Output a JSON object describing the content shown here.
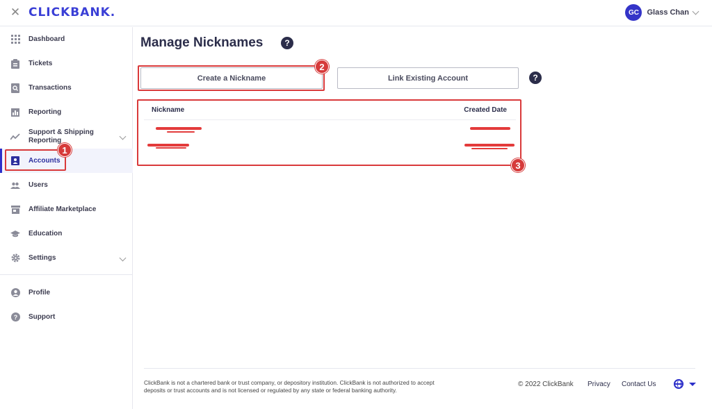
{
  "app": {
    "brand": "CLICKBANK.",
    "user_initials": "GC",
    "user_name": "Glass Chan"
  },
  "sidebar": {
    "items": [
      {
        "label": "Dashboard",
        "icon": "grid-icon"
      },
      {
        "label": "Tickets",
        "icon": "clipboard-icon"
      },
      {
        "label": "Transactions",
        "icon": "receipt-search-icon"
      },
      {
        "label": "Reporting",
        "icon": "bar-chart-icon"
      },
      {
        "label": "Support & Shipping Reporting",
        "icon": "trend-line-icon"
      },
      {
        "label": "Accounts",
        "icon": "account-badge-icon"
      },
      {
        "label": "Users",
        "icon": "users-icon"
      },
      {
        "label": "Affiliate Marketplace",
        "icon": "storefront-icon"
      },
      {
        "label": "Education",
        "icon": "graduation-cap-icon"
      },
      {
        "label": "Settings",
        "icon": "gear-icon"
      },
      {
        "label": "Profile",
        "icon": "person-icon"
      },
      {
        "label": "Support",
        "icon": "help-circle-icon"
      }
    ]
  },
  "main": {
    "title": "Manage Nicknames",
    "help_glyph": "?",
    "create_button": "Create a Nickname",
    "link_button": "Link Existing Account",
    "table": {
      "col_nickname": "Nickname",
      "col_created": "Created Date"
    }
  },
  "annotations": {
    "badge1": "1",
    "badge2": "2",
    "badge3": "3",
    "color": "#d9393a"
  },
  "footer": {
    "disclaimer": "ClickBank is not a chartered bank or trust company, or depository institution. ClickBank is not authorized to accept deposits or trust accounts and is not licensed or regulated by any state or federal banking authority.",
    "copyright": "© 2022 ClickBank",
    "privacy": "Privacy",
    "contact": "Contact Us"
  },
  "colors": {
    "accent": "#2c2fc9",
    "active_bg": "#f2f3fc",
    "text": "#2b2d4a"
  }
}
